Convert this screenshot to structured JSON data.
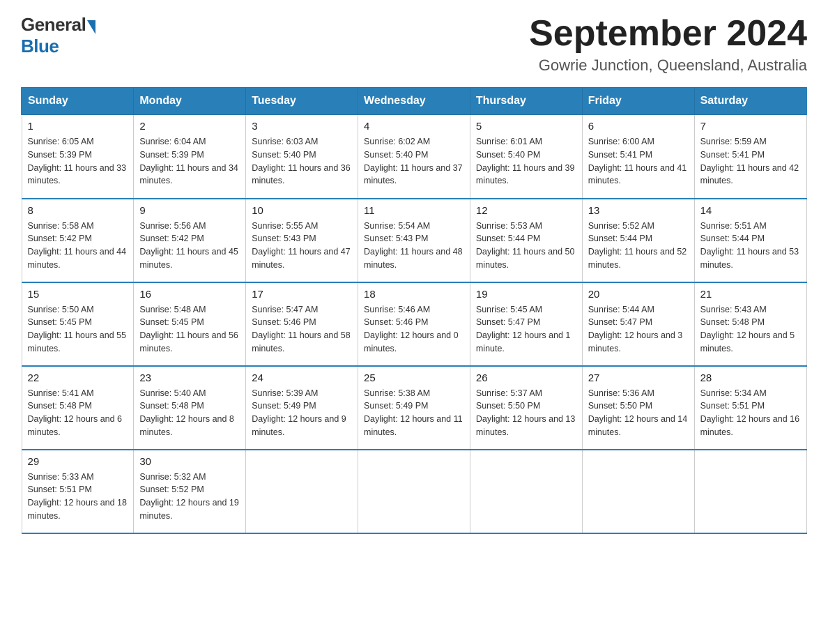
{
  "logo": {
    "text_general": "General",
    "triangle": "",
    "text_blue": "Blue"
  },
  "title": "September 2024",
  "location": "Gowrie Junction, Queensland, Australia",
  "days_of_week": [
    "Sunday",
    "Monday",
    "Tuesday",
    "Wednesday",
    "Thursday",
    "Friday",
    "Saturday"
  ],
  "weeks": [
    [
      {
        "day": "1",
        "sunrise": "Sunrise: 6:05 AM",
        "sunset": "Sunset: 5:39 PM",
        "daylight": "Daylight: 11 hours and 33 minutes."
      },
      {
        "day": "2",
        "sunrise": "Sunrise: 6:04 AM",
        "sunset": "Sunset: 5:39 PM",
        "daylight": "Daylight: 11 hours and 34 minutes."
      },
      {
        "day": "3",
        "sunrise": "Sunrise: 6:03 AM",
        "sunset": "Sunset: 5:40 PM",
        "daylight": "Daylight: 11 hours and 36 minutes."
      },
      {
        "day": "4",
        "sunrise": "Sunrise: 6:02 AM",
        "sunset": "Sunset: 5:40 PM",
        "daylight": "Daylight: 11 hours and 37 minutes."
      },
      {
        "day": "5",
        "sunrise": "Sunrise: 6:01 AM",
        "sunset": "Sunset: 5:40 PM",
        "daylight": "Daylight: 11 hours and 39 minutes."
      },
      {
        "day": "6",
        "sunrise": "Sunrise: 6:00 AM",
        "sunset": "Sunset: 5:41 PM",
        "daylight": "Daylight: 11 hours and 41 minutes."
      },
      {
        "day": "7",
        "sunrise": "Sunrise: 5:59 AM",
        "sunset": "Sunset: 5:41 PM",
        "daylight": "Daylight: 11 hours and 42 minutes."
      }
    ],
    [
      {
        "day": "8",
        "sunrise": "Sunrise: 5:58 AM",
        "sunset": "Sunset: 5:42 PM",
        "daylight": "Daylight: 11 hours and 44 minutes."
      },
      {
        "day": "9",
        "sunrise": "Sunrise: 5:56 AM",
        "sunset": "Sunset: 5:42 PM",
        "daylight": "Daylight: 11 hours and 45 minutes."
      },
      {
        "day": "10",
        "sunrise": "Sunrise: 5:55 AM",
        "sunset": "Sunset: 5:43 PM",
        "daylight": "Daylight: 11 hours and 47 minutes."
      },
      {
        "day": "11",
        "sunrise": "Sunrise: 5:54 AM",
        "sunset": "Sunset: 5:43 PM",
        "daylight": "Daylight: 11 hours and 48 minutes."
      },
      {
        "day": "12",
        "sunrise": "Sunrise: 5:53 AM",
        "sunset": "Sunset: 5:44 PM",
        "daylight": "Daylight: 11 hours and 50 minutes."
      },
      {
        "day": "13",
        "sunrise": "Sunrise: 5:52 AM",
        "sunset": "Sunset: 5:44 PM",
        "daylight": "Daylight: 11 hours and 52 minutes."
      },
      {
        "day": "14",
        "sunrise": "Sunrise: 5:51 AM",
        "sunset": "Sunset: 5:44 PM",
        "daylight": "Daylight: 11 hours and 53 minutes."
      }
    ],
    [
      {
        "day": "15",
        "sunrise": "Sunrise: 5:50 AM",
        "sunset": "Sunset: 5:45 PM",
        "daylight": "Daylight: 11 hours and 55 minutes."
      },
      {
        "day": "16",
        "sunrise": "Sunrise: 5:48 AM",
        "sunset": "Sunset: 5:45 PM",
        "daylight": "Daylight: 11 hours and 56 minutes."
      },
      {
        "day": "17",
        "sunrise": "Sunrise: 5:47 AM",
        "sunset": "Sunset: 5:46 PM",
        "daylight": "Daylight: 11 hours and 58 minutes."
      },
      {
        "day": "18",
        "sunrise": "Sunrise: 5:46 AM",
        "sunset": "Sunset: 5:46 PM",
        "daylight": "Daylight: 12 hours and 0 minutes."
      },
      {
        "day": "19",
        "sunrise": "Sunrise: 5:45 AM",
        "sunset": "Sunset: 5:47 PM",
        "daylight": "Daylight: 12 hours and 1 minute."
      },
      {
        "day": "20",
        "sunrise": "Sunrise: 5:44 AM",
        "sunset": "Sunset: 5:47 PM",
        "daylight": "Daylight: 12 hours and 3 minutes."
      },
      {
        "day": "21",
        "sunrise": "Sunrise: 5:43 AM",
        "sunset": "Sunset: 5:48 PM",
        "daylight": "Daylight: 12 hours and 5 minutes."
      }
    ],
    [
      {
        "day": "22",
        "sunrise": "Sunrise: 5:41 AM",
        "sunset": "Sunset: 5:48 PM",
        "daylight": "Daylight: 12 hours and 6 minutes."
      },
      {
        "day": "23",
        "sunrise": "Sunrise: 5:40 AM",
        "sunset": "Sunset: 5:48 PM",
        "daylight": "Daylight: 12 hours and 8 minutes."
      },
      {
        "day": "24",
        "sunrise": "Sunrise: 5:39 AM",
        "sunset": "Sunset: 5:49 PM",
        "daylight": "Daylight: 12 hours and 9 minutes."
      },
      {
        "day": "25",
        "sunrise": "Sunrise: 5:38 AM",
        "sunset": "Sunset: 5:49 PM",
        "daylight": "Daylight: 12 hours and 11 minutes."
      },
      {
        "day": "26",
        "sunrise": "Sunrise: 5:37 AM",
        "sunset": "Sunset: 5:50 PM",
        "daylight": "Daylight: 12 hours and 13 minutes."
      },
      {
        "day": "27",
        "sunrise": "Sunrise: 5:36 AM",
        "sunset": "Sunset: 5:50 PM",
        "daylight": "Daylight: 12 hours and 14 minutes."
      },
      {
        "day": "28",
        "sunrise": "Sunrise: 5:34 AM",
        "sunset": "Sunset: 5:51 PM",
        "daylight": "Daylight: 12 hours and 16 minutes."
      }
    ],
    [
      {
        "day": "29",
        "sunrise": "Sunrise: 5:33 AM",
        "sunset": "Sunset: 5:51 PM",
        "daylight": "Daylight: 12 hours and 18 minutes."
      },
      {
        "day": "30",
        "sunrise": "Sunrise: 5:32 AM",
        "sunset": "Sunset: 5:52 PM",
        "daylight": "Daylight: 12 hours and 19 minutes."
      },
      null,
      null,
      null,
      null,
      null
    ]
  ]
}
